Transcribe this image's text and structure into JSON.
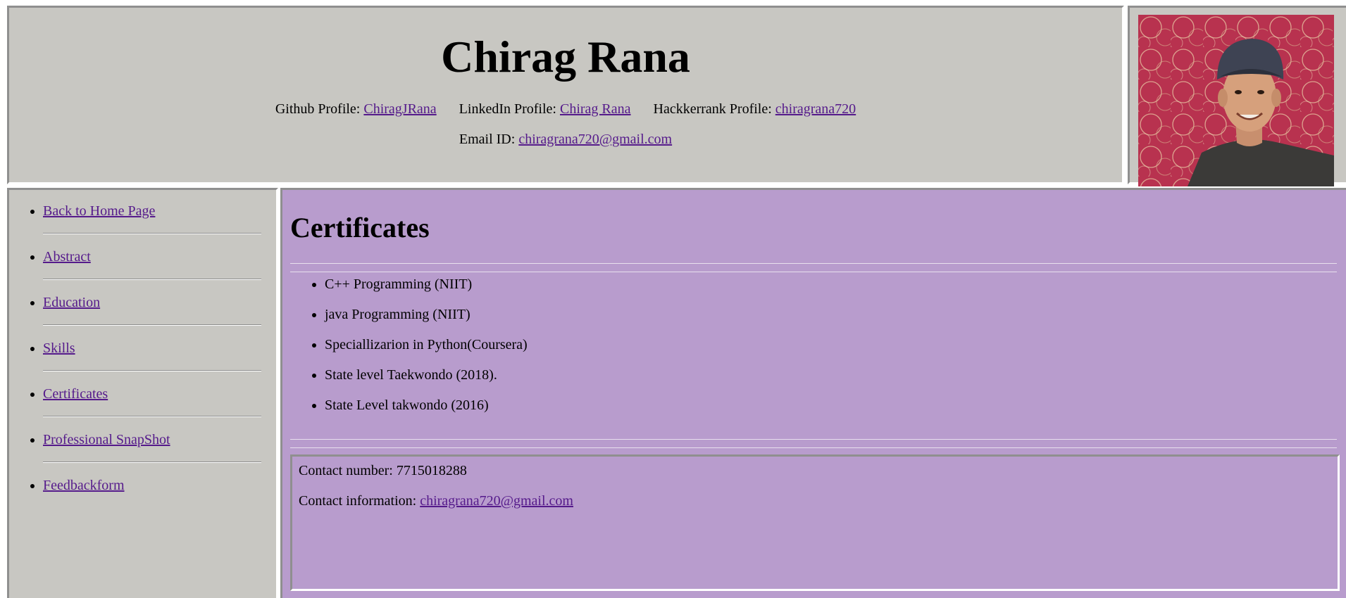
{
  "header": {
    "name": "Chirag Rana",
    "github_label": "Github Profile: ",
    "github_link": "ChiragJRana",
    "linkedin_label": "LinkedIn Profile: ",
    "linkedin_link": "Chirag Rana",
    "hackerrank_label": "Hackkerrank Profile: ",
    "hackerrank_link": "chiragrana720",
    "email_label": "Email ID: ",
    "email_link": "chiragrana720@gmail.com"
  },
  "sidebar": {
    "items": [
      {
        "label": "Back to Home Page"
      },
      {
        "label": "Abstract"
      },
      {
        "label": "Education"
      },
      {
        "label": "Skills"
      },
      {
        "label": "Certificates"
      },
      {
        "label": "Professional SnapShot"
      },
      {
        "label": "Feedbackform"
      }
    ]
  },
  "main": {
    "title": "Certificates",
    "certificates": [
      "C++ Programming (NIIT)",
      "java Programming (NIIT)",
      "Speciallizarion in Python(Coursera)",
      "State level Taekwondo (2018).",
      "State Level takwondo (2016)"
    ],
    "contact": {
      "number_label": "Contact number: ",
      "number_value": "7715018288",
      "info_label": "Contact information: ",
      "info_link": "chiragrana720@gmail.com"
    }
  },
  "colors": {
    "frame_gray": "#c8c7c2",
    "main_purple": "#b89ccd",
    "link": "#551a8b"
  }
}
